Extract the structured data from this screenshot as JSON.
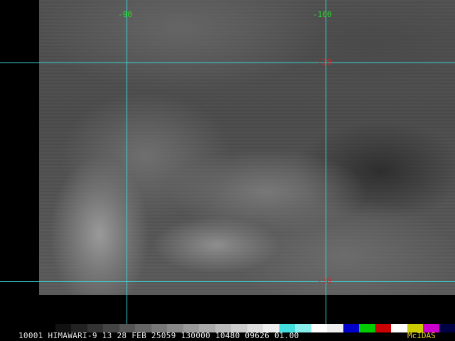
{
  "grid": {
    "longitude_labels": [
      "-90",
      "-100"
    ],
    "latitude_labels": [
      "-20",
      "-30"
    ],
    "line_color": "#3fd6d6",
    "longitude_label_color": "#22dd22",
    "latitude_label_color": "#e02020"
  },
  "status": {
    "text": "10001 HIMAWARI-9 13 28 FEB 25059 130000 10480 09626 01.00",
    "brand": "McIDAS"
  },
  "colorbar": {
    "colors": [
      "#000000",
      "#111111",
      "#222222",
      "#333333",
      "#444444",
      "#555555",
      "#666666",
      "#777777",
      "#888888",
      "#999999",
      "#aaaaaa",
      "#bbbbbb",
      "#cccccc",
      "#dddddd",
      "#eeeeee",
      "#44dddd",
      "#88eeee",
      "#ffffff",
      "#eeeeee",
      "#0000cc",
      "#00cc00",
      "#cc0000",
      "#ffffff",
      "#cccc00",
      "#cc00cc",
      "#000044"
    ]
  }
}
